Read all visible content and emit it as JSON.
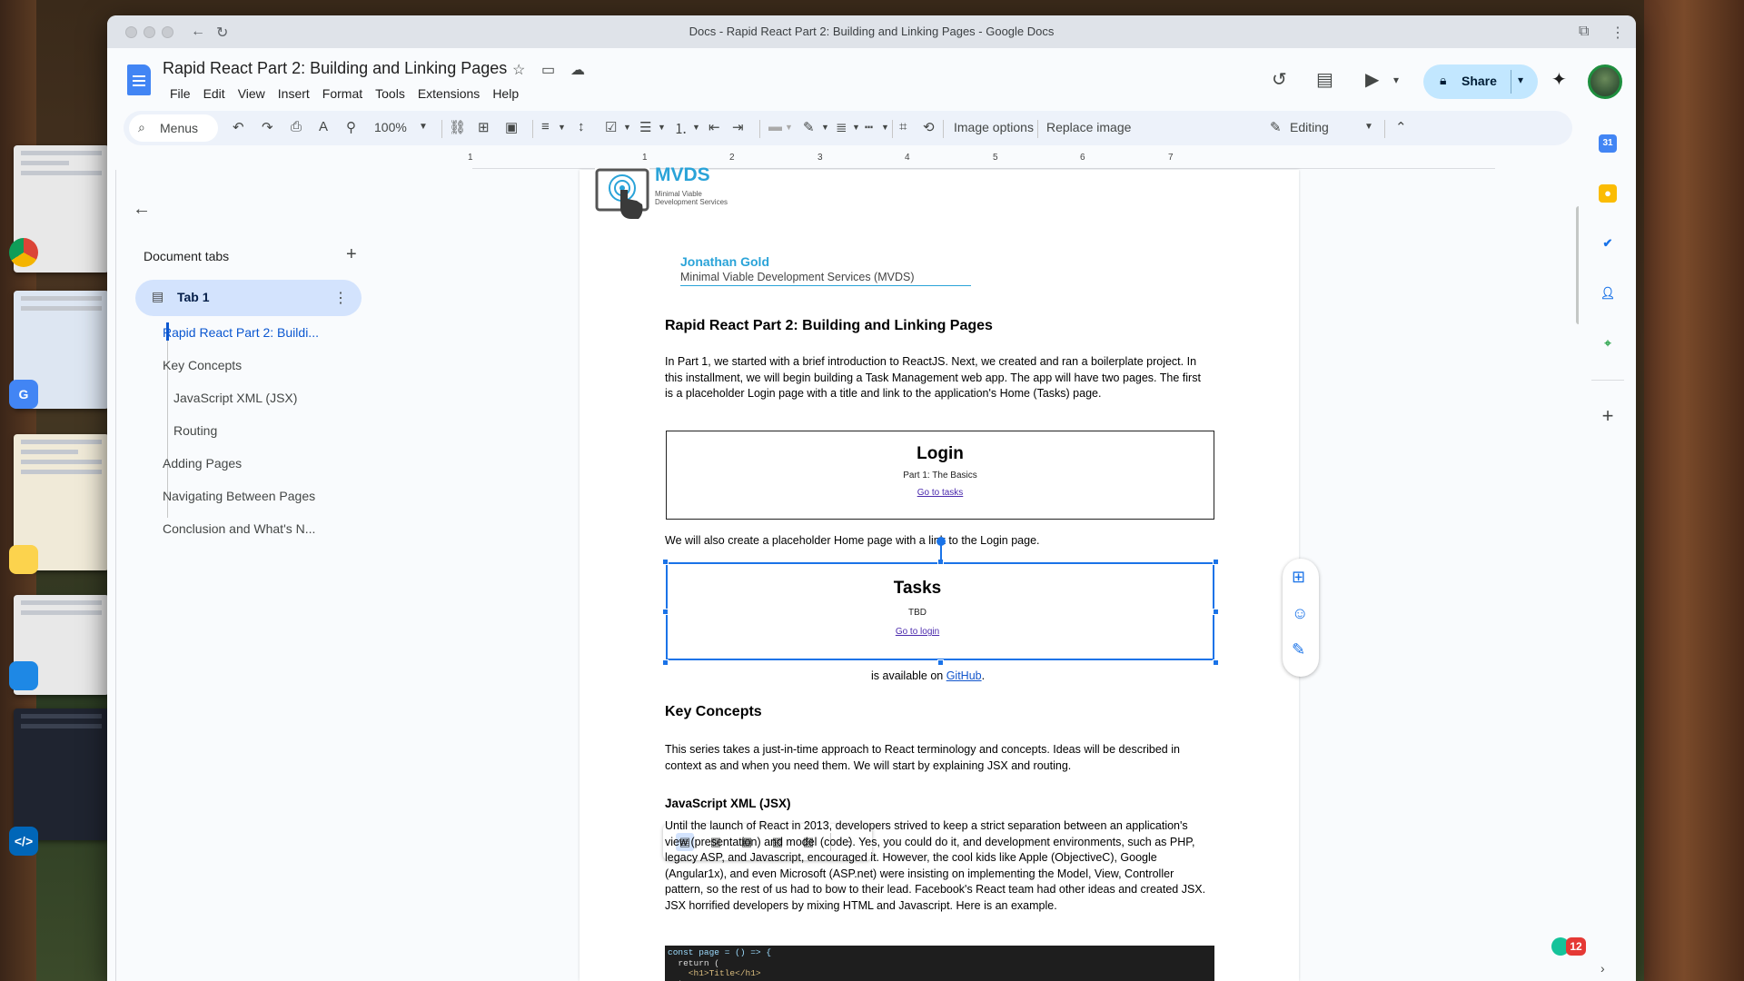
{
  "window": {
    "title": "Docs - Rapid React Part 2: Building and Linking Pages - Google Docs"
  },
  "doc": {
    "title": "Rapid React Part 2: Building and Linking Pages"
  },
  "menu": [
    "File",
    "Edit",
    "View",
    "Insert",
    "Format",
    "Tools",
    "Extensions",
    "Help"
  ],
  "header": {
    "share_label": "Share"
  },
  "toolbar": {
    "menus_label": "Menus",
    "zoom": "100%",
    "image_options": "Image options",
    "replace_image": "Replace image",
    "mode": "Editing"
  },
  "ruler": [
    "1",
    "1",
    "2",
    "3",
    "4",
    "5",
    "6",
    "7"
  ],
  "sidebar": {
    "tabs_title": "Document tabs",
    "tab_name": "Tab 1",
    "outline": [
      {
        "label": "Rapid React Part 2: Buildi...",
        "level": 1,
        "active": true
      },
      {
        "label": "Key Concepts",
        "level": 1,
        "active": false
      },
      {
        "label": "JavaScript XML (JSX)",
        "level": 2,
        "active": false
      },
      {
        "label": "Routing",
        "level": 2,
        "active": false
      },
      {
        "label": "Adding Pages",
        "level": 1,
        "active": false
      },
      {
        "label": "Navigating Between Pages",
        "level": 1,
        "active": false
      },
      {
        "label": "Conclusion and What's N...",
        "level": 1,
        "active": false
      }
    ]
  },
  "page": {
    "logo_text": "MVDS",
    "logo_sub1": "Minimal Viable",
    "logo_sub2": "Development Services",
    "author": "Jonathan Gold",
    "company": "Minimal Viable Development Services (MVDS)",
    "heading": "Rapid React Part 2: Building and Linking Pages",
    "intro": "In Part 1, we started with a brief introduction to ReactJS. Next, we created and ran a boilerplate project. In this installment, we will begin building a Task Management web app. The app will have two pages. The first is a placeholder Login page with a title and link to the application's Home (Tasks) page.",
    "login_img": {
      "title": "Login",
      "subtitle": "Part 1: The Basics",
      "link": "Go to tasks"
    },
    "home_para": "We will also create a placeholder Home page with a link to the Login page.",
    "tasks_img": {
      "title": "Tasks",
      "subtitle": "TBD",
      "link": "Go to login"
    },
    "github_pre": "is available on ",
    "github_link": "GitHub",
    "github_post": ".",
    "key_concepts": "Key Concepts",
    "key_para": "This series takes a just-in-time approach to React terminology and concepts. Ideas will be described in context as and when you need them. We will start by explaining JSX and routing.",
    "jsx_heading": "JavaScript XML (JSX)",
    "jsx_para": "Until the launch of React in 2013, developers strived to keep a strict separation between an application's view (presentation) and model (code). Yes, you could do it, and development environments, such as PHP, legacy ASP, and Javascript, encouraged it. However, the cool kids like Apple (ObjectiveC), Google (Angular1x), and even Microsoft (ASP.net) were insisting on implementing the Model, View, Controller pattern, so the rest of us had to bow to their lead. Facebook's React team had other ideas and created JSX. JSX horrified developers by mixing HTML and Javascript. Here is an example.",
    "code": [
      "const page = () => {",
      "  return (",
      "    <h1>Title</h1>",
      "  );"
    ]
  },
  "badge_count": "12"
}
